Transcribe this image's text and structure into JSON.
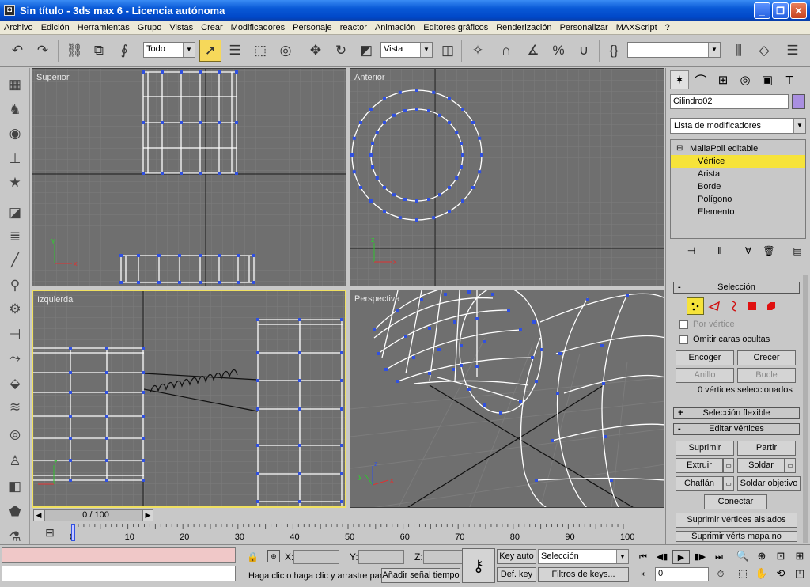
{
  "window": {
    "title": "Sin título - 3ds max 6 - Licencia autónoma",
    "app_icon": "3ds-max-icon",
    "controls": [
      "minimize",
      "maximize",
      "close"
    ]
  },
  "menu": [
    "Archivo",
    "Edición",
    "Herramientas",
    "Grupo",
    "Vistas",
    "Crear",
    "Modificadores",
    "Personaje",
    "reactor",
    "Animación",
    "Editores gráficos",
    "Renderización",
    "Personalizar",
    "MAXScript",
    "?"
  ],
  "toolbar": {
    "selection_filter": "Todo",
    "reference_coord": "Vista",
    "named_selection": ""
  },
  "viewports": {
    "top": "Superior",
    "front": "Anterior",
    "left": "Izquierda",
    "perspective": "Perspectiva"
  },
  "time_slider": {
    "value": "0 / 100"
  },
  "track_ticks": [
    "0",
    "10",
    "20",
    "30",
    "40",
    "50",
    "60",
    "70",
    "80",
    "90",
    "100"
  ],
  "command_panel": {
    "object_name": "Cilindro02",
    "object_color": "#a98fe0",
    "modifier_list": "Lista de modificadores",
    "stack": {
      "base": "MallaPoli editable",
      "subobjects": [
        "Vértice",
        "Arista",
        "Borde",
        "Polígono",
        "Elemento"
      ],
      "selected": "Vértice"
    },
    "selection": {
      "title": "Selección",
      "by_vertex": "Por vértice",
      "ignore_backfacing": "Omitir caras ocultas",
      "grow": "Crecer",
      "shrink": "Encoger",
      "ring": "Anillo",
      "loop": "Bucle",
      "status": "0 vértices seleccionados"
    },
    "soft_selection": {
      "title": "Selección flexible"
    },
    "edit_vertices": {
      "title": "Editar vértices",
      "remove": "Suprimir",
      "break": "Partir",
      "extrude": "Extruir",
      "weld": "Soldar",
      "chamfer": "Chaflán",
      "target_weld": "Soldar objetivo",
      "connect": "Conectar",
      "remove_isolated": "Suprimir vértices aislados",
      "remove_unused": "Suprimir vérts mapa no usados"
    }
  },
  "status_bar": {
    "prompt": "Haga clic o haga clic y arrastre par",
    "add_time_tag": "Añadir señal tiempo",
    "x_label": "X:",
    "y_label": "Y:",
    "z_label": "Z:",
    "key_auto": "Key auto",
    "set_key": "Def. key",
    "key_mode": "Selección",
    "key_filters": "Filtros de keys...",
    "current_frame": "0"
  }
}
